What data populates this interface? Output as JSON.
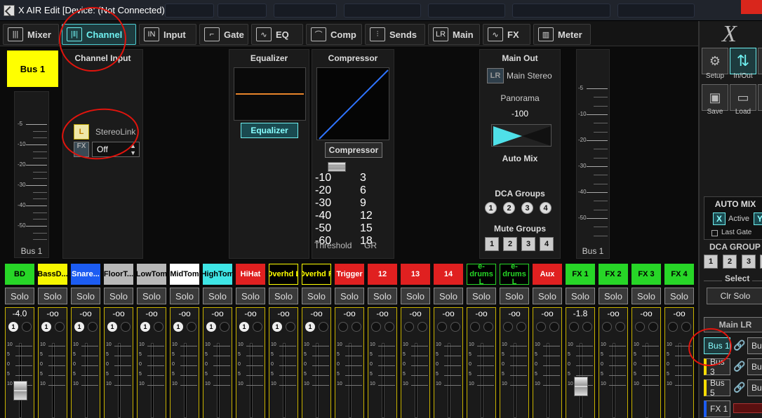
{
  "window": {
    "title": "X AIR Edit [Device: (Not Connected)]"
  },
  "tabs": [
    {
      "label": "Mixer",
      "icon": "mixer-faders-icon"
    },
    {
      "label": "Channel",
      "icon": "channel-faders-icon"
    },
    {
      "label": "Input",
      "icon": "input-icon"
    },
    {
      "label": "Gate",
      "icon": "gate-icon"
    },
    {
      "label": "EQ",
      "icon": "eq-curve-icon"
    },
    {
      "label": "Comp",
      "icon": "comp-curve-icon"
    },
    {
      "label": "Sends",
      "icon": "sends-icon"
    },
    {
      "label": "Main",
      "icon": "main-lr-icon"
    },
    {
      "label": "FX",
      "icon": "fx-wave-icon"
    },
    {
      "label": "Meter",
      "icon": "meter-bars-icon"
    }
  ],
  "active_tab": "Channel",
  "channel": {
    "name": "Bus 1",
    "name_color": "#ffff00",
    "meter_scale": [
      "-5",
      "-10",
      "-20",
      "-30",
      "-40",
      "-50"
    ],
    "meter_label": "Bus 1"
  },
  "channel_input": {
    "title": "Channel Input",
    "link_badge": "L",
    "stereo_link": "StereoLink",
    "fx_badge": "FX",
    "fx_source": "Off"
  },
  "equalizer": {
    "title": "Equalizer",
    "button": "Equalizer"
  },
  "compressor": {
    "title": "Compressor",
    "button": "Compressor",
    "threshold_scale": [
      "-10",
      "-20",
      "-30",
      "-40",
      "-50",
      "-60"
    ],
    "gr_scale": [
      "3",
      "6",
      "9",
      "12",
      "15",
      "18"
    ],
    "threshold_label": "Threshold",
    "gr_label": "GR"
  },
  "main_out": {
    "title": "Main Out",
    "badge": "LR",
    "main_stereo": "Main Stereo",
    "panorama_label": "Panorama",
    "panorama_value": "-100",
    "auto_mix_label": "Auto Mix",
    "dca_title": "DCA Groups",
    "dca": [
      "1",
      "2",
      "3",
      "4"
    ],
    "mute_title": "Mute Groups",
    "mute": [
      "1",
      "2",
      "3",
      "4"
    ]
  },
  "out_meter": {
    "scale": [
      "-5",
      "-10",
      "-20",
      "-30",
      "-40",
      "-50"
    ],
    "label": "Bus 1"
  },
  "strips": [
    {
      "name": "BD",
      "color": "#27d627",
      "text": "#000",
      "value": "-4.0",
      "ch1": true,
      "fader": 0.55
    },
    {
      "name": "BassD...",
      "color": "#f7f700",
      "text": "#000",
      "value": "-oo",
      "ch1": true
    },
    {
      "name": "Snare...",
      "color": "#1c5cf2",
      "text": "#fff",
      "value": "-oo",
      "ch1": true
    },
    {
      "name": "FloorT...",
      "color": "#b8b8b8",
      "text": "#000",
      "value": "-oo",
      "ch1": true
    },
    {
      "name": "LowTom",
      "color": "#b8b8b8",
      "text": "#000",
      "value": "-oo",
      "ch1": true
    },
    {
      "name": "MidTom",
      "color": "#ffffff",
      "text": "#000",
      "value": "-oo",
      "ch1": true
    },
    {
      "name": "HighTom",
      "color": "#3ee5e5",
      "text": "#000",
      "value": "-oo",
      "ch1": true
    },
    {
      "name": "HiHat",
      "color": "#e02020",
      "text": "#fff",
      "value": "-oo",
      "ch1": true
    },
    {
      "name": "Overhd L",
      "color": "#000000",
      "text": "#ffff00",
      "border": "#ffff00",
      "value": "-oo",
      "ch1": true
    },
    {
      "name": "Overhd R",
      "color": "#000000",
      "text": "#ffff00",
      "border": "#ffff00",
      "value": "-oo",
      "ch1": true
    },
    {
      "name": "Trigger",
      "color": "#e02020",
      "text": "#fff",
      "value": "-oo",
      "ch1": false
    },
    {
      "name": "12",
      "color": "#e02020",
      "text": "#fff",
      "value": "-oo",
      "ch1": false
    },
    {
      "name": "13",
      "color": "#e02020",
      "text": "#fff",
      "value": "-oo",
      "ch1": false
    },
    {
      "name": "14",
      "color": "#e02020",
      "text": "#fff",
      "value": "-oo",
      "ch1": false
    },
    {
      "name": "e-drums L",
      "color": "#000000",
      "text": "#27d627",
      "border": "#27d627",
      "value": "-oo",
      "ch1": false
    },
    {
      "name": "e-drums L",
      "color": "#000000",
      "text": "#27d627",
      "border": "#27d627",
      "value": "-oo",
      "ch1": false
    },
    {
      "name": "Aux",
      "color": "#e02020",
      "text": "#fff",
      "value": "-oo",
      "ch1": false
    },
    {
      "name": "FX 1",
      "color": "#27d627",
      "text": "#000",
      "value": "-1.8",
      "ch1": false,
      "fader": 0.6
    },
    {
      "name": "FX 2",
      "color": "#27d627",
      "text": "#000",
      "value": "-oo",
      "ch1": false
    },
    {
      "name": "FX 3",
      "color": "#27d627",
      "text": "#000",
      "value": "-oo",
      "ch1": false
    },
    {
      "name": "FX 4",
      "color": "#27d627",
      "text": "#000",
      "value": "-oo",
      "ch1": false
    }
  ],
  "strip_solo_label": "Solo",
  "strip_scale": [
    "10",
    "5",
    "0",
    "5",
    "10"
  ],
  "right_panel": {
    "setup_label": "Setup",
    "inout_label": "In/Out",
    "save_label": "Save",
    "load_label": "Load",
    "auto_mix_title": "AUTO MIX",
    "x_badge": "X",
    "active_label": "Active",
    "y_badge": "Y",
    "last_gate_label": "Last Gate",
    "dca_title": "DCA GROUP",
    "dca": [
      "1",
      "2",
      "3"
    ],
    "select_label": "Select",
    "clr_solo_label": "Clr Solo",
    "main_lr_label": "Main LR",
    "buses": [
      "Bus 1",
      "Bus 3",
      "Bus 5",
      "FX 1"
    ],
    "buses_right": [
      "Bus",
      "Bus",
      "Bus"
    ]
  },
  "colors": {
    "accent": "#6ff0f0",
    "highlight_yellow": "#ffff00",
    "annotation_red": "#e0140d"
  }
}
